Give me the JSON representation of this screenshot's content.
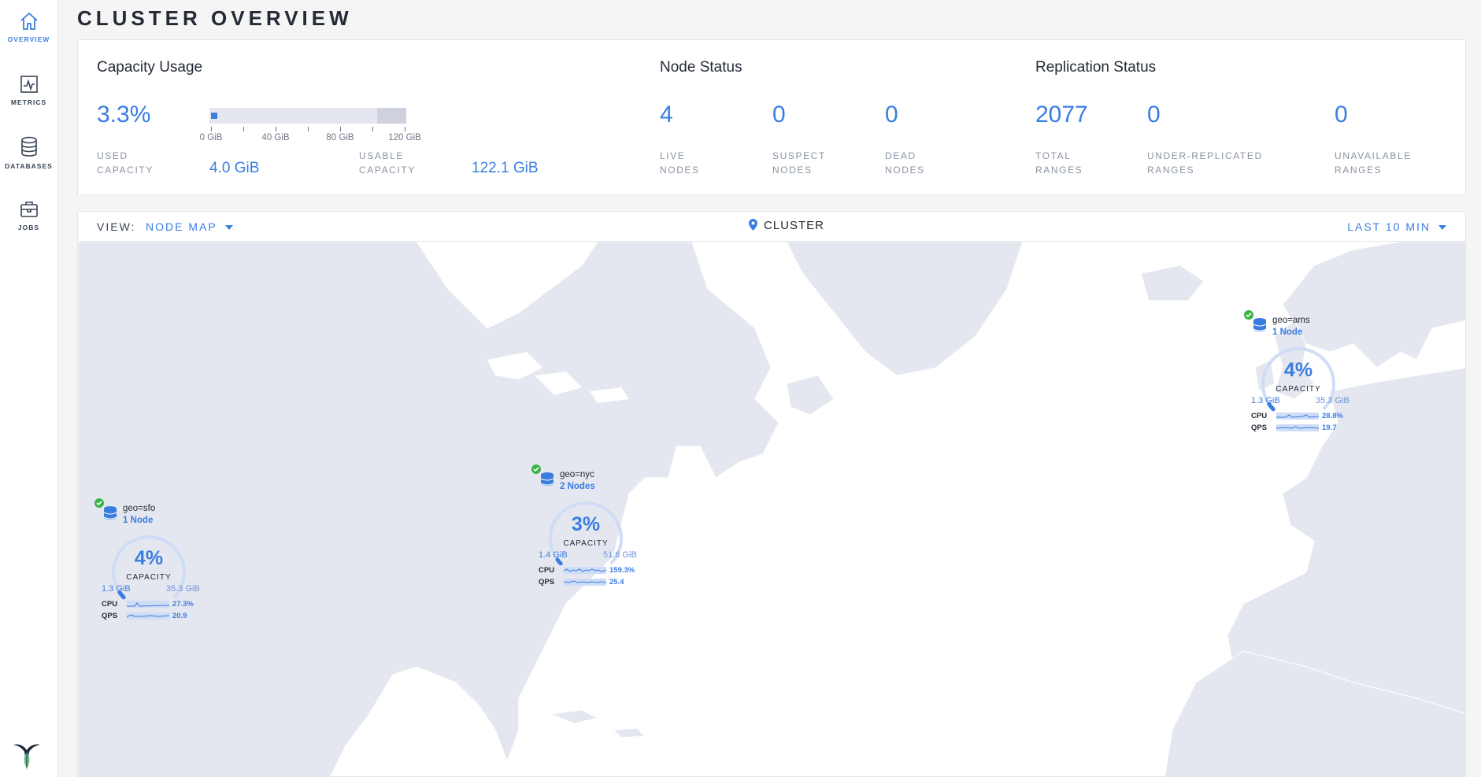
{
  "sidebar": {
    "items": [
      {
        "label": "OVERVIEW",
        "icon": "home-icon",
        "active": true
      },
      {
        "label": "METRICS",
        "icon": "chart-icon",
        "active": false
      },
      {
        "label": "DATABASES",
        "icon": "database-icon",
        "active": false
      },
      {
        "label": "JOBS",
        "icon": "briefcase-icon",
        "active": false
      }
    ]
  },
  "page": {
    "title": "CLUSTER OVERVIEW"
  },
  "capacity": {
    "title": "Capacity Usage",
    "percent": "3.3%",
    "used_label_1": "USED",
    "used_label_2": "CAPACITY",
    "used_value": "4.0 GiB",
    "usable_label_1": "USABLE",
    "usable_label_2": "CAPACITY",
    "usable_value": "122.1 GiB",
    "ticks": [
      "0 GiB",
      "40 GiB",
      "80 GiB",
      "120 GiB"
    ]
  },
  "node_status": {
    "title": "Node Status",
    "live": "4",
    "live_l1": "LIVE",
    "live_l2": "NODES",
    "suspect": "0",
    "suspect_l1": "SUSPECT",
    "suspect_l2": "NODES",
    "dead": "0",
    "dead_l1": "DEAD",
    "dead_l2": "NODES"
  },
  "replication": {
    "title": "Replication Status",
    "total": "2077",
    "total_l1": "TOTAL",
    "total_l2": "RANGES",
    "under": "0",
    "under_l1": "UNDER-REPLICATED",
    "under_l2": "RANGES",
    "unavail": "0",
    "unavail_l1": "UNAVAILABLE",
    "unavail_l2": "RANGES"
  },
  "toolbar": {
    "view_label": "VIEW:",
    "view_value": "NODE MAP",
    "breadcrumb": "CLUSTER",
    "time_value": "LAST 10 MIN"
  },
  "localities": [
    {
      "name": "geo=sfo",
      "count": "1 Node",
      "capacity_pct": "4%",
      "capacity_label": "CAPACITY",
      "used": "1.3 GiB",
      "usable": "35.3 GiB",
      "cpu_label": "CPU",
      "cpu": "27.3%",
      "qps_label": "QPS",
      "qps": "20.9",
      "fill": 0.04
    },
    {
      "name": "geo=nyc",
      "count": "2 Nodes",
      "capacity_pct": "3%",
      "capacity_label": "CAPACITY",
      "used": "1.4 GiB",
      "usable": "51.6 GiB",
      "cpu_label": "CPU",
      "cpu": "159.3%",
      "qps_label": "QPS",
      "qps": "25.4",
      "fill": 0.03
    },
    {
      "name": "geo=ams",
      "count": "1 Node",
      "capacity_pct": "4%",
      "capacity_label": "CAPACITY",
      "used": "1.3 GiB",
      "usable": "35.3 GiB",
      "cpu_label": "CPU",
      "cpu": "28.8%",
      "qps_label": "QPS",
      "qps": "19.7",
      "fill": 0.04
    }
  ],
  "colors": {
    "accent": "#3a7de1",
    "land": "#e5e7f0",
    "healthy": "#3bb346"
  }
}
